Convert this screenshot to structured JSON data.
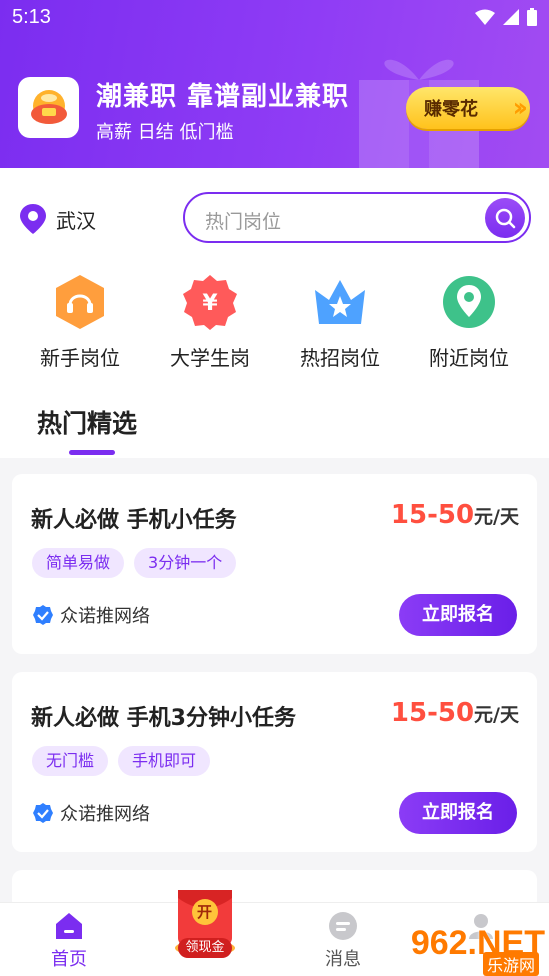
{
  "status_bar": {
    "time": "5:13"
  },
  "header": {
    "title": "潮兼职 靠谱副业兼职",
    "subtitle": "高薪 日结 低门槛",
    "earn_button": "赚零花"
  },
  "location": {
    "city": "武汉"
  },
  "search": {
    "placeholder": "热门岗位"
  },
  "categories": [
    {
      "label": "新手岗位",
      "icon": "headset-icon"
    },
    {
      "label": "大学生岗",
      "icon": "yuan-badge-icon"
    },
    {
      "label": "热招岗位",
      "icon": "crown-icon"
    },
    {
      "label": "附近岗位",
      "icon": "map-pin-icon"
    }
  ],
  "section": {
    "title": "热门精选"
  },
  "jobs": [
    {
      "title": "新人必做 手机小任务",
      "salary": "15-50",
      "unit": "元/天",
      "tags": [
        "简单易做",
        "3分钟一个"
      ],
      "company": "众诺推网络",
      "apply_label": "立即报名"
    },
    {
      "title": "新人必做 手机3分钟小任务",
      "salary": "15-50",
      "unit": "元/天",
      "tags": [
        "无门槛",
        "手机即可"
      ],
      "company": "众诺推网络",
      "apply_label": "立即报名"
    }
  ],
  "redpacket": {
    "open": "开",
    "label": "领现金"
  },
  "tabbar": [
    {
      "label": "首页",
      "icon": "home-icon",
      "active": true
    },
    {
      "label": "",
      "icon": "red-packet-icon",
      "active": false
    },
    {
      "label": "消息",
      "icon": "message-icon",
      "active": false
    },
    {
      "label": "",
      "icon": "user-icon",
      "active": false
    }
  ],
  "watermark": {
    "brand": "962.NET",
    "sub": "乐游网"
  },
  "colors": {
    "primary": "#7b2df0",
    "salary": "#ff4f3f",
    "tag_bg": "#f0e6ff"
  }
}
